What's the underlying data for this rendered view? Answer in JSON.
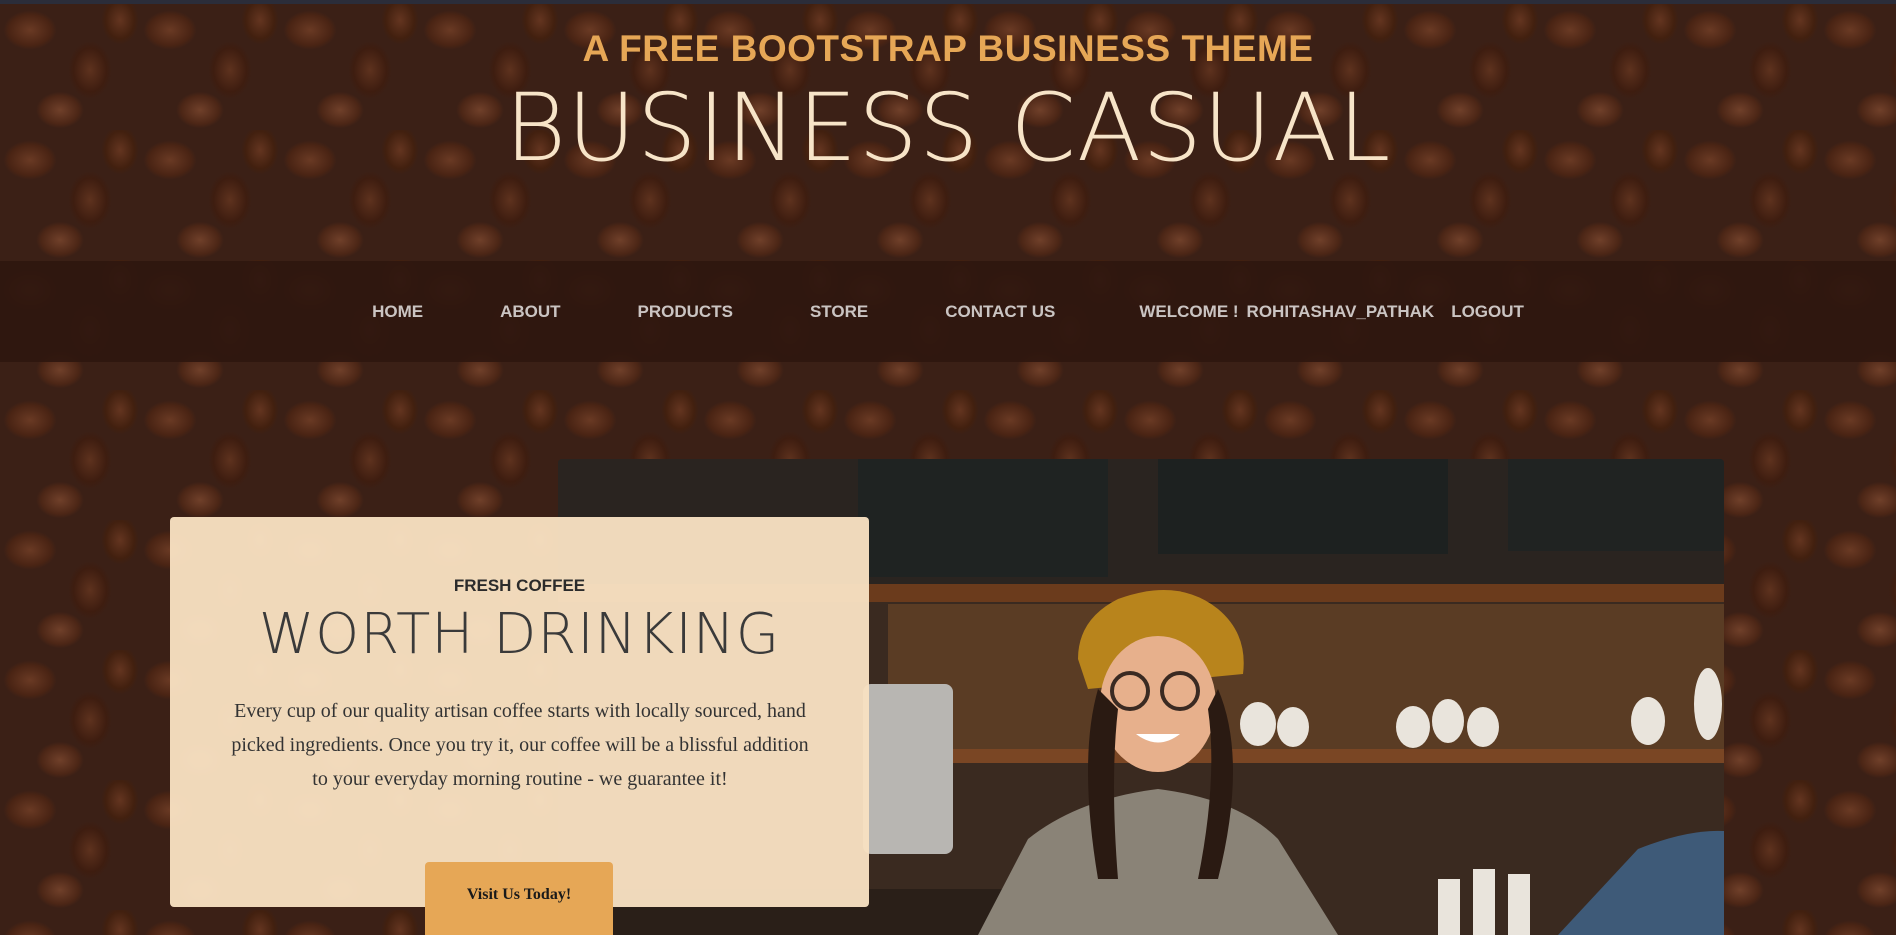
{
  "header": {
    "tagline": "A FREE BOOTSTRAP BUSINESS THEME",
    "brand": "BUSINESS CASUAL"
  },
  "nav": {
    "items": [
      {
        "label": "HOME"
      },
      {
        "label": "ABOUT"
      },
      {
        "label": "PRODUCTS"
      },
      {
        "label": "STORE"
      },
      {
        "label": "CONTACT US"
      }
    ],
    "welcome": "WELCOME !",
    "username": "ROHITASHAV_PATHAK",
    "logout": "LOGOUT"
  },
  "intro": {
    "subheading": "FRESH COFFEE",
    "heading": "WORTH DRINKING",
    "body": "Every cup of our quality artisan coffee starts with locally sourced, hand picked ingredients. Once you try it, our coffee will be a blissful addition to your everyday morning routine - we guarantee it!",
    "button": "Visit Us Today!"
  },
  "colors": {
    "accent": "#e6a756",
    "brand_text": "#f7e4c8",
    "card_bg": "#f8e1c2",
    "nav_bg": "#2f170f"
  }
}
